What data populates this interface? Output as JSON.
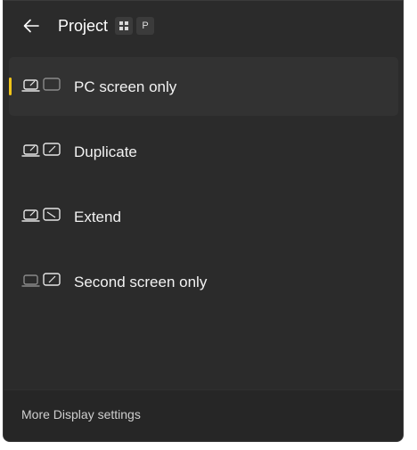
{
  "header": {
    "title": "Project",
    "shortcut": {
      "windows_key_icon": "windows-logo-icon",
      "letter": "P"
    },
    "back_icon": "arrow-left-icon"
  },
  "options": [
    {
      "label": "PC screen only",
      "icon": "pc-screen-only-icon",
      "selected": true
    },
    {
      "label": "Duplicate",
      "icon": "duplicate-icon",
      "selected": false
    },
    {
      "label": "Extend",
      "icon": "extend-icon",
      "selected": false
    },
    {
      "label": "Second screen only",
      "icon": "second-screen-only-icon",
      "selected": false
    }
  ],
  "footer": {
    "link_label": "More Display settings"
  },
  "colors": {
    "background": "#2b2b2b",
    "selected_background": "#323232",
    "accent": "#f0c419",
    "footer_background": "#262626"
  }
}
